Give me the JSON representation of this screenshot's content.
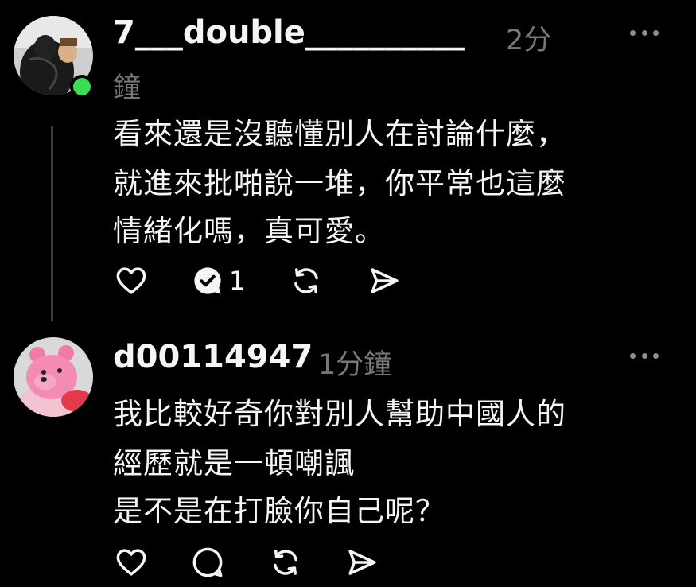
{
  "comments": [
    {
      "username": "7___double__________",
      "time_part1": "2分",
      "time_part2": "鐘",
      "online": true,
      "text_lines": [
        "看來還是沒聽懂別人在討論什麼，",
        "就進來批啪說一堆，你平常也這麼",
        "情緒化嗎，真可愛。"
      ],
      "reply_count": "1",
      "actions": [
        "like-icon",
        "reply-icon",
        "repost-icon",
        "share-icon"
      ]
    },
    {
      "username": "d00114947",
      "time": "1分鐘",
      "text_lines": [
        "我比較好奇你對別人幫助中國人的",
        "經歷就是一頓嘲諷",
        "是不是在打臉你自己呢？"
      ],
      "actions": [
        "like-icon",
        "reply-icon",
        "repost-icon",
        "share-icon"
      ]
    }
  ],
  "colors": {
    "background": "#000000",
    "text": "#f3f5f7",
    "muted": "#777777",
    "online": "#3ddc56"
  }
}
